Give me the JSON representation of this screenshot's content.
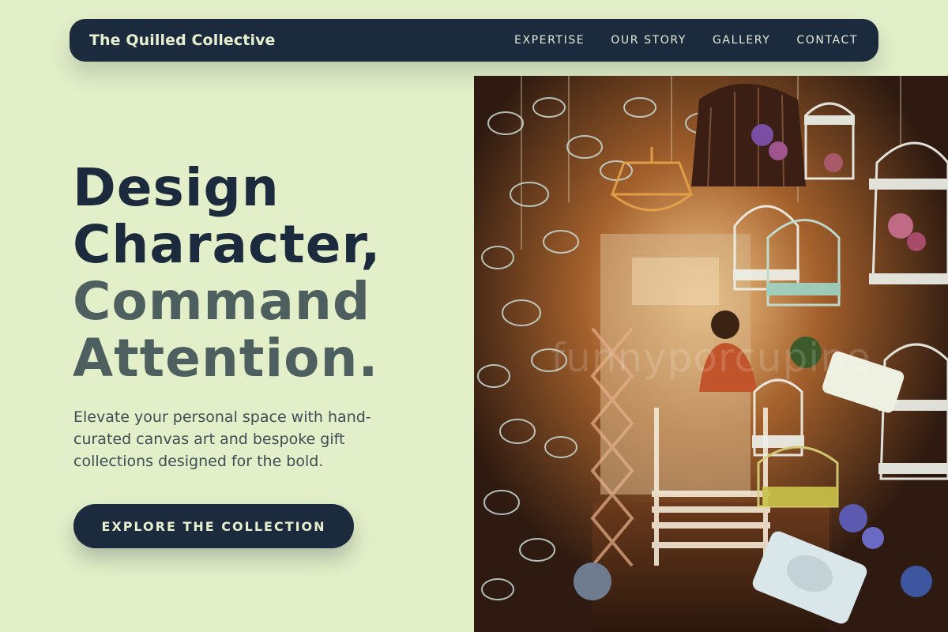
{
  "nav": {
    "brand": "The Quilled Collective",
    "links": [
      "EXPERTISE",
      "OUR STORY",
      "GALLERY",
      "CONTACT"
    ]
  },
  "hero": {
    "title_lines": [
      "Design",
      "Character,",
      "Command",
      "Attention."
    ],
    "subtitle": "Elevate your personal space with hand-curated canvas art and bespoke gift collections designed for the bold.",
    "cta_label": "EXPLORE THE COLLECTION"
  },
  "photo": {
    "watermark": "funnyporcupine"
  },
  "colors": {
    "background": "#e3efc8",
    "navy": "#1c2a3d",
    "muted_title": "#4e5f5f",
    "body_text": "#3f4e55"
  }
}
